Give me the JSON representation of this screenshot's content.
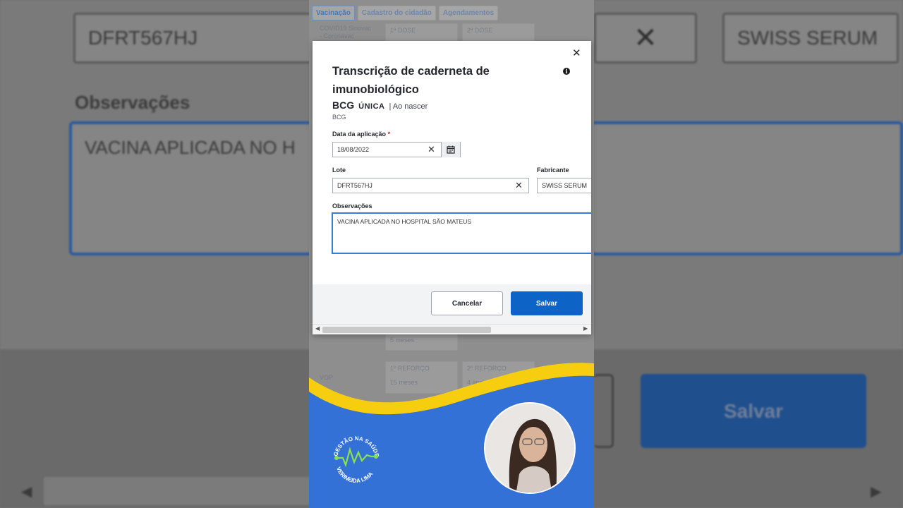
{
  "background": {
    "lote_value": "DFRT567HJ",
    "fabricante_value": "SWISS SERUM",
    "observacoes_label": "Observações",
    "observacoes_value": "VACINA APLICADA NO H",
    "save_label": "Salvar"
  },
  "tabs": [
    {
      "label": "Vacinação",
      "active": true
    },
    {
      "label": "Cadastro do cidadão",
      "active": false
    },
    {
      "label": "Agendamentos",
      "active": false
    }
  ],
  "behind_rows": {
    "covid_label": "COVID19 Sinovac - Coronavac",
    "covid_dose1": "1ª DOSE",
    "covid_dose2": "2ª DOSE",
    "row_sub": "5 meses",
    "vop_label": "VOP",
    "vop_dose1": "1º REFORÇO",
    "vop_dose1_sub": "15 meses",
    "vop_dose2": "2º REFORÇO",
    "vop_dose2_sub": "4 anos"
  },
  "modal": {
    "title": "Transcrição de caderneta de imunobiológico",
    "vaccine_name": "BCG",
    "dose": "ÚNICA",
    "when": "| Ao nascer",
    "vaccine_sub": "BCG",
    "date_label": "Data da aplicação",
    "date_required": "*",
    "date_value": "18/08/2022",
    "lote_label": "Lote",
    "lote_value": "DFRT567HJ",
    "fabricante_label": "Fabricante",
    "fabricante_value": "SWISS SERUM",
    "obs_label": "Observações",
    "obs_value": "VACINA APLICADA NO HOSPITAL SÃO MATEUS",
    "cancel_label": "Cancelar",
    "save_label": "Salvar"
  },
  "branding": {
    "logo_top": "GESTÃO NA SAÚDE",
    "logo_bottom": "VERINEIDA LIMA"
  },
  "colors": {
    "primary": "#0e63c7",
    "brand_blue": "#3471d6",
    "brand_yellow": "#f6cd0f",
    "logo_green": "#8be04e"
  }
}
